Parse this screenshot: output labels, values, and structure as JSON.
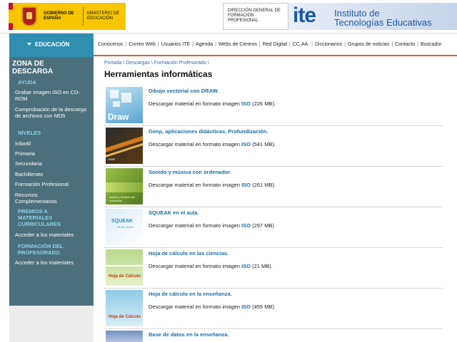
{
  "header": {
    "gobierno_line": "GOBIERNO DE ESPAÑA",
    "ministerio_line": "MINISTERIO DE EDUCACIÓN",
    "direccion_line": "DIRECCIÓN GENERAL DE FORMACIÓN PROFESIONAL",
    "ite_logo": "ite",
    "ite_name_line1": "Instituto de",
    "ite_name_line2": "Tecnologías Educativas"
  },
  "sidebar": {
    "section_button": "EDUCACIÓN",
    "zone_title_line1": "ZONA DE",
    "zone_title_line2": "DESCARGA",
    "ayuda_heading": "AYUDA",
    "ayuda_items": [
      "Grabar imagen ISO en CD-ROM",
      "Comprobación de la descarga de archivos con MD5"
    ],
    "niveles_heading": "NIVELES",
    "niveles_items": [
      "Infantil",
      "Primaria",
      "Secundaria",
      "Bachillerato",
      "Formación Profesional",
      "Recursos Complementarios"
    ],
    "premios_heading": "PREMIOS A MATERIALES CURRICULARES",
    "premios_link": "Acceder a los materiales",
    "formacion_heading": "FORMACIÓN DEL PROFESORADO",
    "formacion_link": "Acceder a los materiales"
  },
  "nav": {
    "items": [
      "Conócenos",
      "Correo Web",
      "Usuarios ITE",
      "Agenda",
      "Webs de Centros",
      "Red Digital",
      "CC.AA.",
      "Diccionarios",
      "Grupos de noticias",
      "Contacto",
      "Buscador"
    ]
  },
  "breadcrumb": [
    "Portada",
    "Descargas",
    "Formación Profesorado"
  ],
  "page_title": "Herramientas informáticas",
  "items": [
    {
      "title": "Dibujo vectorial con DRAW.",
      "desc_prefix": "Descargar material en formato imagen",
      "iso": "ISO",
      "size": "(226 MB).",
      "thumb_label": "Draw"
    },
    {
      "title": "Gimp, aplicaciones didácticas. Profundización.",
      "desc_prefix": "Descargar material en formato imagen",
      "iso": "ISO",
      "size": "(541 MB).",
      "thumb_label": "GIMP"
    },
    {
      "title": "Sonido y música con ordenador.",
      "desc_prefix": "Descargar material en formato imagen",
      "iso": "ISO",
      "size": "(261 MB).",
      "thumb_label": "sonido y música con ordenador"
    },
    {
      "title": "SQUEAK en el aula.",
      "desc_prefix": "Descargar material en formato imagen",
      "iso": "ISO",
      "size": "(297 MB)",
      "thumb_label": "SQUEAK",
      "thumb_sub": "EN EL AULA"
    },
    {
      "title": "Hoja de cálculo en las ciencias.",
      "desc_prefix": "Descargar material en formato imagen",
      "iso": "ISO",
      "size": "(21 MB).",
      "thumb_label": "Hoja de Cálculo"
    },
    {
      "title": "Hoja de cálculo en la enseñanza.",
      "desc_prefix": "Descargar material en formato imagen",
      "iso": "ISO",
      "size": "(455 MB).",
      "thumb_label": "Hoja de Cálculo"
    },
    {
      "title": "Base de datos en la enseñanza.",
      "desc_prefix": "",
      "iso": "",
      "size": "",
      "thumb_label": ""
    }
  ],
  "colors": {
    "sidebar_bg": "#4c6f7d",
    "edu_bar": "#2e8fb0",
    "link_blue": "#1d6fa5",
    "nav_underline": "#d05a3a"
  }
}
